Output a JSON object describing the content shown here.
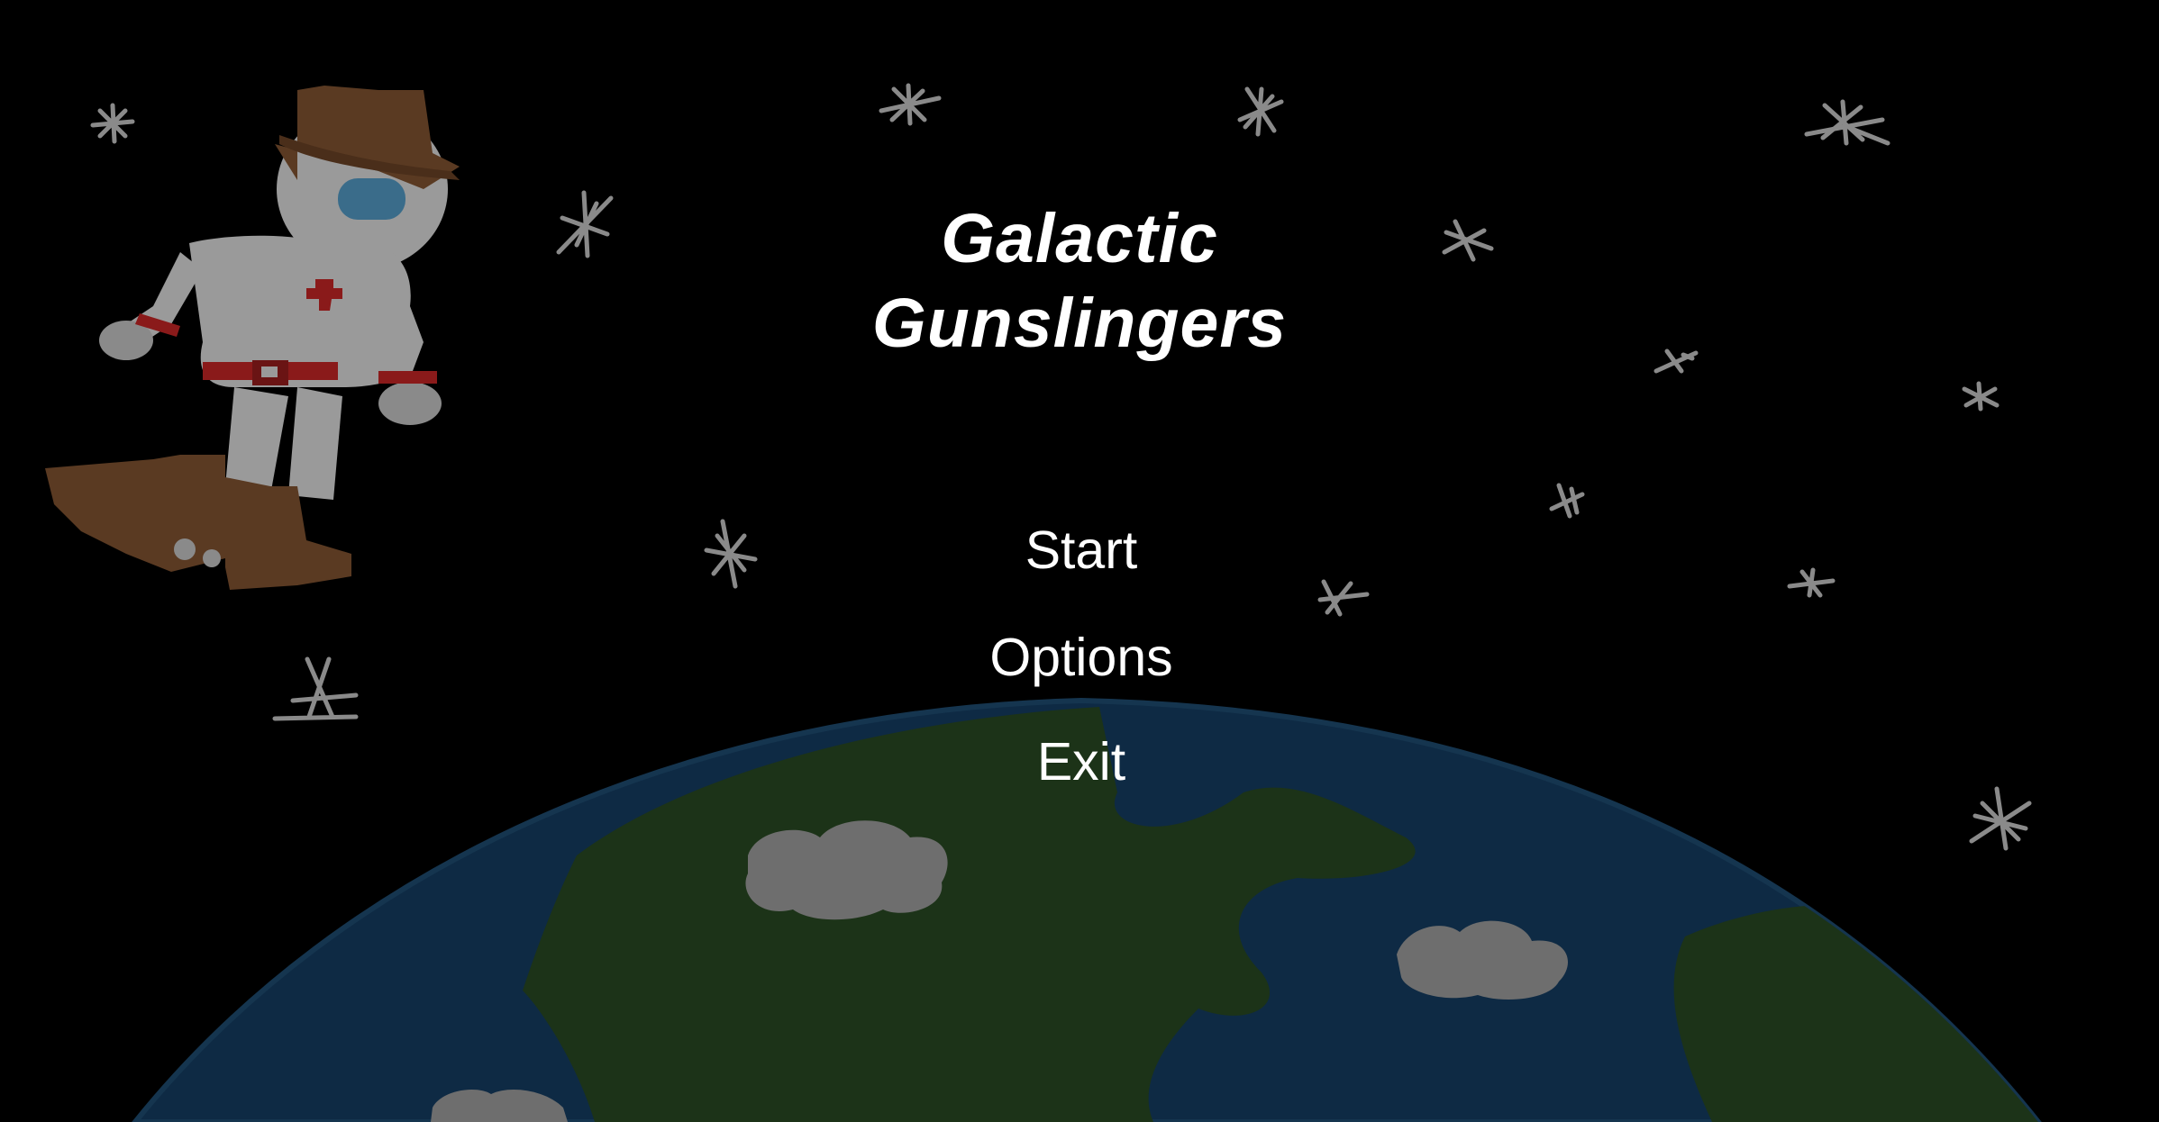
{
  "game": {
    "title_line_1": "Galactic",
    "title_line_2": "Gunslingers"
  },
  "menu": {
    "items": [
      {
        "label": "Start"
      },
      {
        "label": "Options"
      },
      {
        "label": "Exit"
      }
    ]
  },
  "colors": {
    "background": "#000000",
    "text": "#ffffff",
    "star": "#8a8a8a",
    "ocean": "#0e2a44",
    "land": "#1c3318",
    "cloud": "#6e6e6e",
    "astronaut_suit": "#9a9a9a",
    "hat_boots": "#5a3a22",
    "accent_red": "#8a1a1a",
    "visor": "#3a6c8a"
  }
}
